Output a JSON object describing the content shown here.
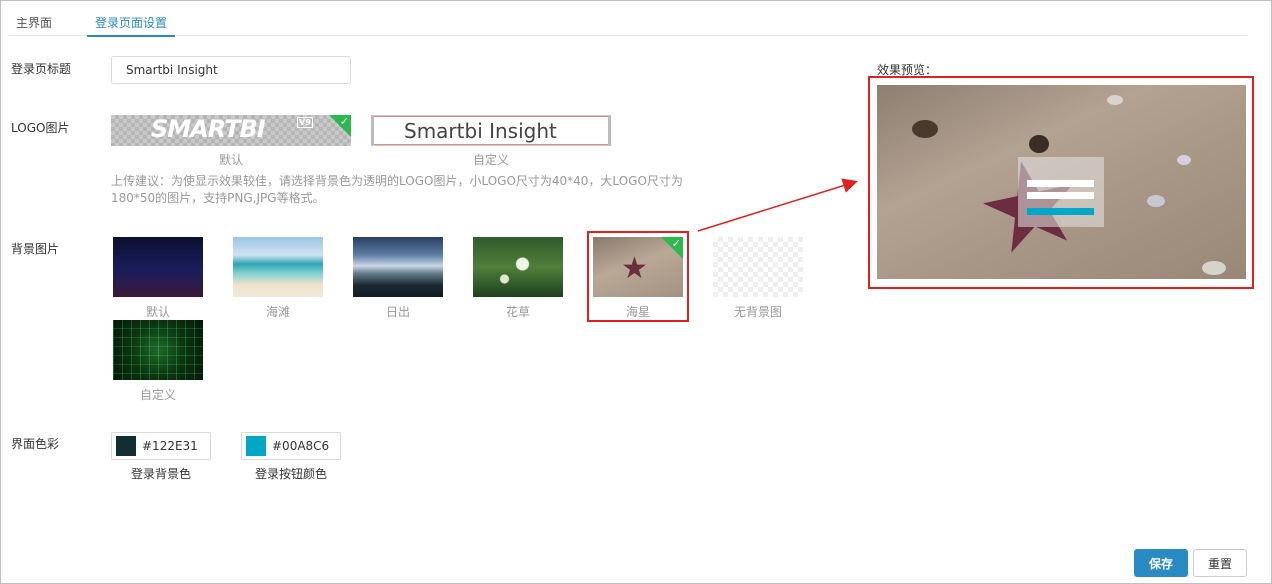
{
  "tabs": [
    {
      "label": "主界面",
      "active": false
    },
    {
      "label": "登录页面设置",
      "active": true
    }
  ],
  "title_field": {
    "label": "登录页标题",
    "value": "Smartbi Insight"
  },
  "logo": {
    "label": "LOGO图片",
    "default_text": "SMARTBI",
    "default_version": "V9",
    "default_caption": "默认",
    "custom_text": "Smartbi Insight",
    "custom_caption": "自定义",
    "selected": "默认",
    "hint": "上传建议：为使显示效果较佳，请选择背景色为透明的LOGO图片，小LOGO尺寸为40*40，大LOGO尺寸为180*50的图片，支持PNG,JPG等格式。"
  },
  "background": {
    "label": "背景图片",
    "items": [
      {
        "caption": "默认"
      },
      {
        "caption": "海滩"
      },
      {
        "caption": "日出"
      },
      {
        "caption": "花草"
      },
      {
        "caption": "海星",
        "selected": true
      },
      {
        "caption": "无背景图"
      },
      {
        "caption": "自定义"
      }
    ]
  },
  "colors": {
    "label": "界面色彩",
    "login_bg": {
      "hex": "#122E31",
      "caption": "登录背景色"
    },
    "login_button": {
      "hex": "#00A8C6",
      "caption": "登录按钮颜色"
    }
  },
  "preview": {
    "label": "效果预览："
  },
  "actions": {
    "save": "保存",
    "reset": "重置"
  },
  "accent_color": "#2a8bc4",
  "highlight_color": "#e12020",
  "icons": {
    "check": "check-icon"
  }
}
